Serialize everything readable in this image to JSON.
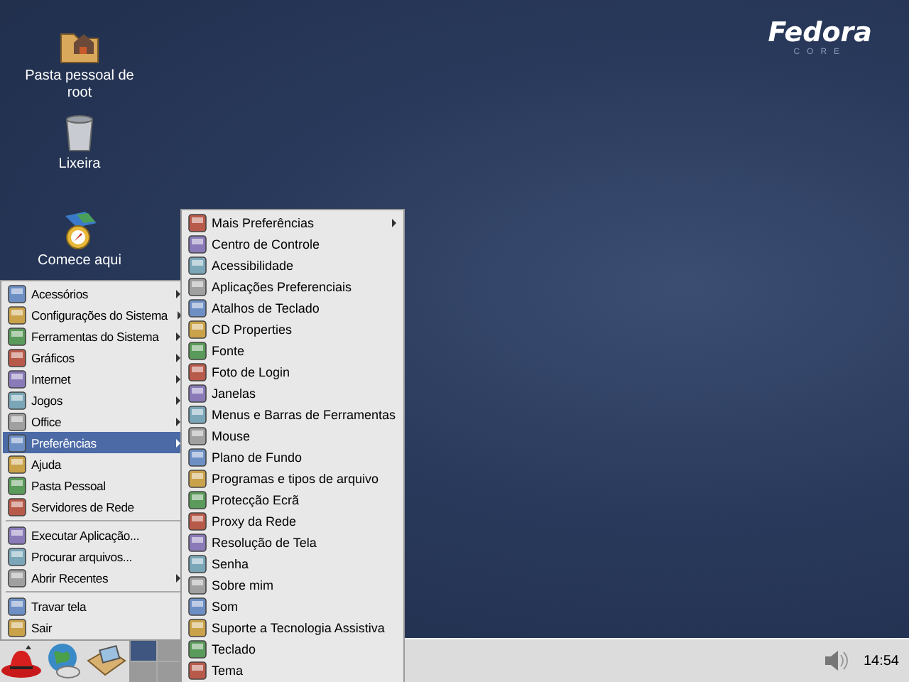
{
  "desktop": {
    "logo": {
      "title": "Fedora",
      "subtitle": "CORE"
    },
    "icons": [
      {
        "label": "Pasta pessoal de root"
      },
      {
        "label": "Lixeira"
      },
      {
        "label": "Comece aqui"
      }
    ]
  },
  "main_menu": {
    "sections": [
      [
        {
          "label": "Acessórios",
          "has_submenu": true,
          "selected": false
        },
        {
          "label": "Configurações do Sistema",
          "has_submenu": true,
          "selected": false
        },
        {
          "label": "Ferramentas do Sistema",
          "has_submenu": true,
          "selected": false
        },
        {
          "label": "Gráficos",
          "has_submenu": true,
          "selected": false
        },
        {
          "label": "Internet",
          "has_submenu": true,
          "selected": false
        },
        {
          "label": "Jogos",
          "has_submenu": true,
          "selected": false
        },
        {
          "label": "Office",
          "has_submenu": true,
          "selected": false
        },
        {
          "label": "Preferências",
          "has_submenu": true,
          "selected": true
        },
        {
          "label": "Ajuda",
          "has_submenu": false,
          "selected": false
        },
        {
          "label": "Pasta Pessoal",
          "has_submenu": false,
          "selected": false
        },
        {
          "label": "Servidores de Rede",
          "has_submenu": false,
          "selected": false
        }
      ],
      [
        {
          "label": "Executar Aplicação...",
          "has_submenu": false,
          "selected": false
        },
        {
          "label": "Procurar arquivos...",
          "has_submenu": false,
          "selected": false
        },
        {
          "label": "Abrir Recentes",
          "has_submenu": true,
          "selected": false
        }
      ],
      [
        {
          "label": "Travar tela",
          "has_submenu": false,
          "selected": false
        },
        {
          "label": "Sair",
          "has_submenu": false,
          "selected": false
        }
      ]
    ]
  },
  "submenu": {
    "items": [
      {
        "label": "Mais Preferências",
        "has_submenu": true
      },
      {
        "label": "Centro de Controle",
        "has_submenu": false
      },
      {
        "label": "Acessibilidade",
        "has_submenu": false
      },
      {
        "label": "Aplicações Preferenciais",
        "has_submenu": false
      },
      {
        "label": "Atalhos de Teclado",
        "has_submenu": false
      },
      {
        "label": "CD Properties",
        "has_submenu": false
      },
      {
        "label": "Fonte",
        "has_submenu": false
      },
      {
        "label": "Foto de Login",
        "has_submenu": false
      },
      {
        "label": "Janelas",
        "has_submenu": false
      },
      {
        "label": "Menus e Barras de Ferramentas",
        "has_submenu": false
      },
      {
        "label": "Mouse",
        "has_submenu": false
      },
      {
        "label": "Plano de Fundo",
        "has_submenu": false
      },
      {
        "label": "Programas e tipos de arquivo",
        "has_submenu": false
      },
      {
        "label": "Protecção Ecrã",
        "has_submenu": false
      },
      {
        "label": "Proxy da Rede",
        "has_submenu": false
      },
      {
        "label": "Resolução de Tela",
        "has_submenu": false
      },
      {
        "label": "Senha",
        "has_submenu": false
      },
      {
        "label": "Sobre mim",
        "has_submenu": false
      },
      {
        "label": "Som",
        "has_submenu": false
      },
      {
        "label": "Suporte a Tecnologia Assistiva",
        "has_submenu": false
      },
      {
        "label": "Teclado",
        "has_submenu": false
      },
      {
        "label": "Tema",
        "has_submenu": false
      }
    ]
  },
  "panel": {
    "workspaces": [
      {
        "selected": true
      },
      {
        "selected": false
      },
      {
        "selected": false
      },
      {
        "selected": false
      }
    ],
    "clock": "14:54"
  }
}
